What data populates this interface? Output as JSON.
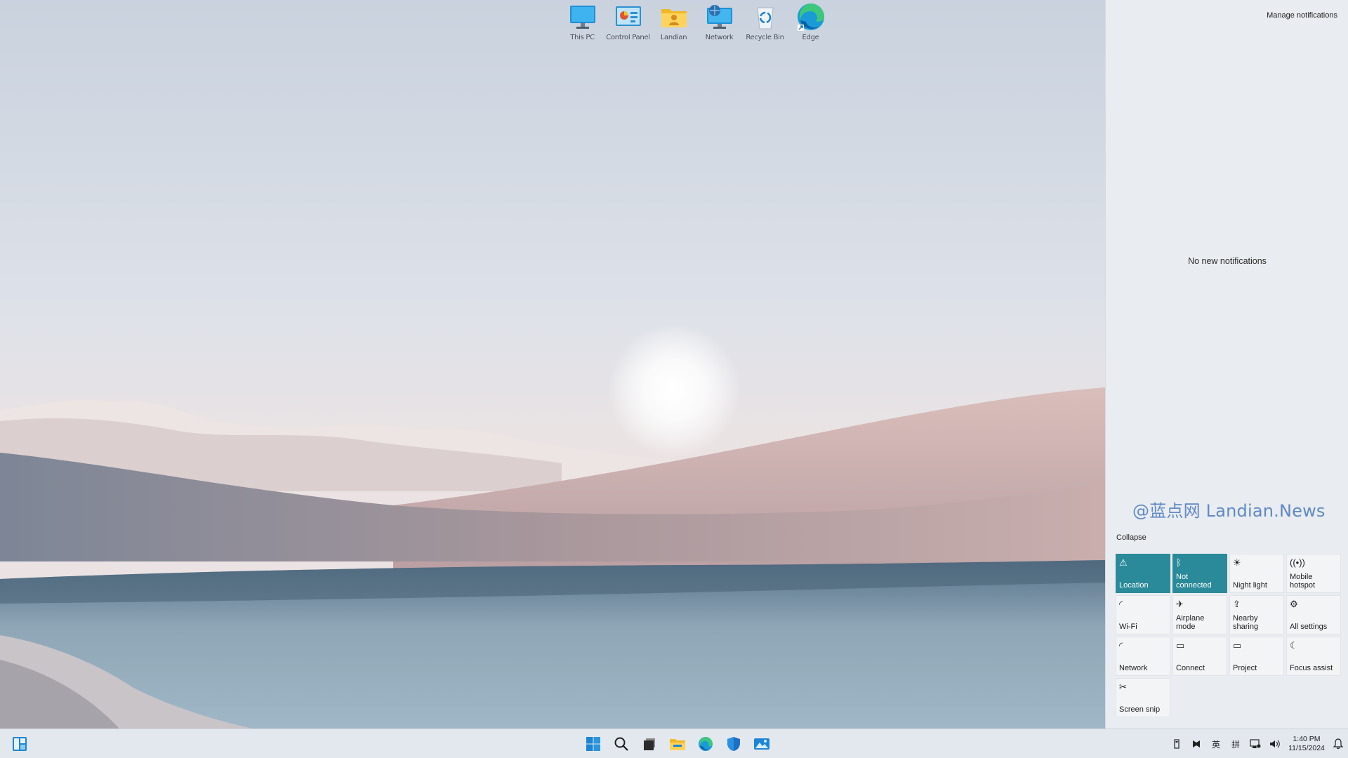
{
  "desktop": {
    "icons": [
      {
        "label": "This PC",
        "icon": "monitor-icon"
      },
      {
        "label": "Control Panel",
        "icon": "control-panel-icon"
      },
      {
        "label": "Landian",
        "icon": "user-folder-icon"
      },
      {
        "label": "Network",
        "icon": "network-icon"
      },
      {
        "label": "Recycle Bin",
        "icon": "recycle-bin-icon"
      },
      {
        "label": "Edge",
        "icon": "edge-icon"
      }
    ]
  },
  "action_center": {
    "manage_label": "Manage notifications",
    "empty_text": "No new notifications",
    "watermark": "@蓝点网 Landian.News",
    "collapse_label": "Collapse",
    "accent": "#2a8a99",
    "tiles": [
      {
        "label": "Location",
        "glyph": "⚠",
        "icon": "location-icon",
        "active": true
      },
      {
        "label": "Not connected",
        "glyph": "ᛒ",
        "icon": "bluetooth-icon",
        "active": true
      },
      {
        "label": "Night light",
        "glyph": "☀",
        "icon": "night-light-icon",
        "active": false
      },
      {
        "label": "Mobile hotspot",
        "glyph": "((•))",
        "icon": "hotspot-icon",
        "active": false
      },
      {
        "label": "Wi-Fi",
        "glyph": "◜",
        "icon": "wifi-icon",
        "active": false
      },
      {
        "label": "Airplane mode",
        "glyph": "✈",
        "icon": "airplane-icon",
        "active": false
      },
      {
        "label": "Nearby sharing",
        "glyph": "⇪",
        "icon": "nearby-sharing-icon",
        "active": false
      },
      {
        "label": "All settings",
        "glyph": "⚙",
        "icon": "settings-icon",
        "active": false
      },
      {
        "label": "Network",
        "glyph": "◜",
        "icon": "network-tile-icon",
        "active": false
      },
      {
        "label": "Connect",
        "glyph": "▭",
        "icon": "connect-icon",
        "active": false
      },
      {
        "label": "Project",
        "glyph": "▭",
        "icon": "project-icon",
        "active": false
      },
      {
        "label": "Focus assist",
        "glyph": "☾",
        "icon": "focus-assist-icon",
        "active": false
      },
      {
        "label": "Screen snip",
        "glyph": "✂",
        "icon": "screen-snip-icon",
        "active": false
      }
    ]
  },
  "taskbar": {
    "apps": [
      "start-icon",
      "search-icon",
      "task-view-icon",
      "file-explorer-icon",
      "edge-icon",
      "security-icon",
      "photos-icon"
    ],
    "tray": {
      "ime_lang": "英",
      "ime_mode": "拼",
      "time": "1:40 PM",
      "date": "11/15/2024"
    }
  }
}
